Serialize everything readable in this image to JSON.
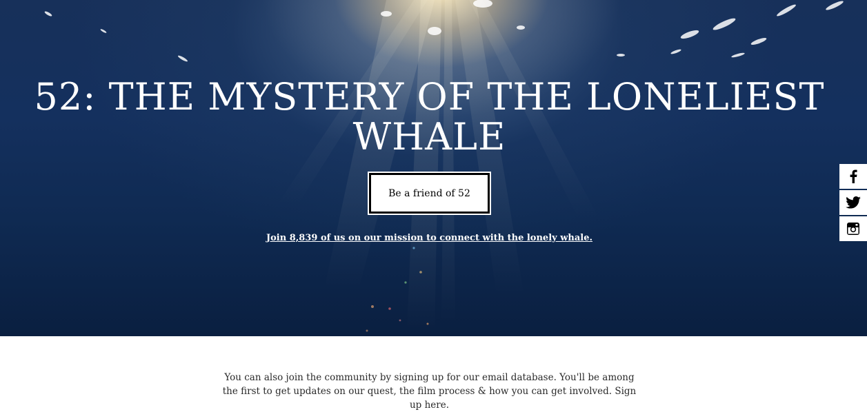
{
  "hero": {
    "title": "52: THE MYSTERY OF THE LONELIEST WHALE",
    "cta_label": "Be a friend of 52",
    "join_text": "Join 8,839 of us on our mission to connect with the lonely whale."
  },
  "social": {
    "items": [
      {
        "name": "facebook",
        "icon": "facebook-icon"
      },
      {
        "name": "twitter",
        "icon": "twitter-icon"
      },
      {
        "name": "instagram",
        "icon": "instagram-icon"
      }
    ]
  },
  "content": {
    "intro_text": "You can also join the community by signing up for our email database. You'll be among the first to get updates on our quest, the film process & how you can get involved. Sign up here."
  },
  "colors": {
    "hero_water": "#14305e",
    "text_dark": "#2a2a2a",
    "button_bg": "#ffffff",
    "button_border": "#000000"
  }
}
